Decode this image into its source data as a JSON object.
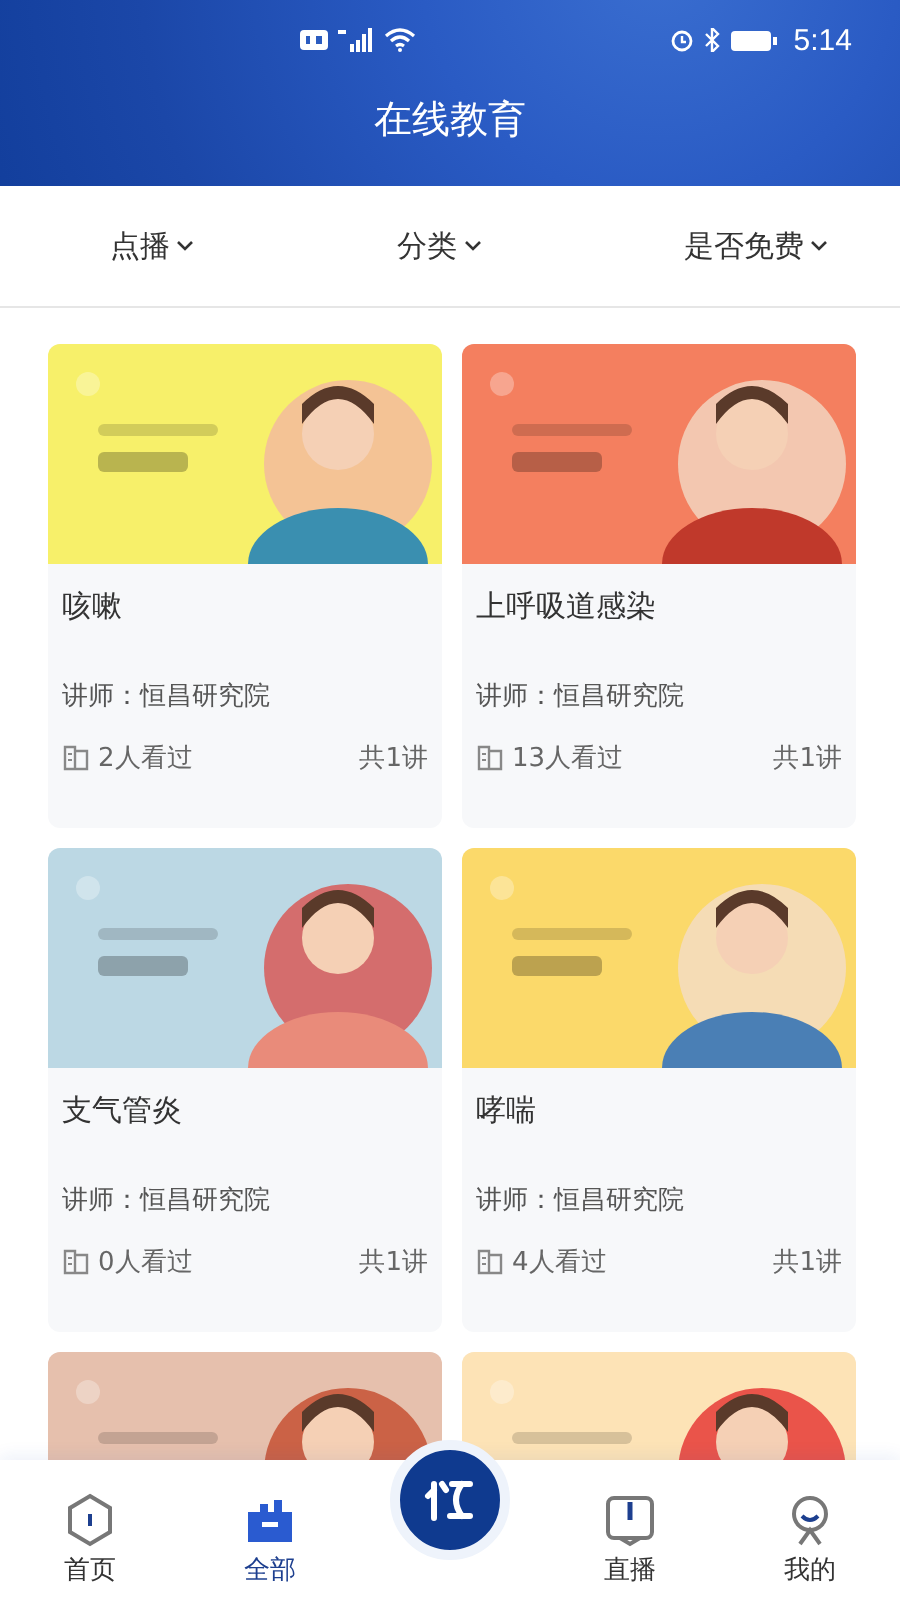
{
  "status_bar": {
    "time": "5:14"
  },
  "header": {
    "title": "在线教育"
  },
  "filters": [
    {
      "label": "点播"
    },
    {
      "label": "分类"
    },
    {
      "label": "是否免费"
    }
  ],
  "cards": [
    {
      "thumbnail": {
        "kind": "picture"
      },
      "title": "咳嗽",
      "lecturer": "讲师：恒昌研究院",
      "views": "2人看过",
      "lessons": "共1讲"
    },
    {
      "thumbnail": {
        "kind": "picture"
      },
      "title": "上呼吸道感染",
      "lecturer": "讲师：恒昌研究院",
      "views": "13人看过",
      "lessons": "共1讲"
    },
    {
      "thumbnail": {
        "kind": "picture"
      },
      "title": "支气管炎",
      "lecturer": "讲师：恒昌研究院",
      "views": "0人看过",
      "lessons": "共1讲"
    },
    {
      "thumbnail": {
        "kind": "picture"
      },
      "title": "哮喘",
      "lecturer": "讲师：恒昌研究院",
      "views": "4人看过",
      "lessons": "共1讲"
    },
    {
      "thumbnail": {
        "kind": "picture"
      }
    },
    {
      "thumbnail": {
        "kind": "picture"
      }
    }
  ],
  "tab_bar": [
    {
      "label": "首页",
      "kind": "home",
      "selected": false
    },
    {
      "label": "全部",
      "kind": "all",
      "selected": true
    },
    {
      "kind": "logo",
      "selected": false
    },
    {
      "label": "直播",
      "kind": "live",
      "selected": false
    },
    {
      "label": "我的",
      "kind": "me",
      "selected": false
    }
  ]
}
